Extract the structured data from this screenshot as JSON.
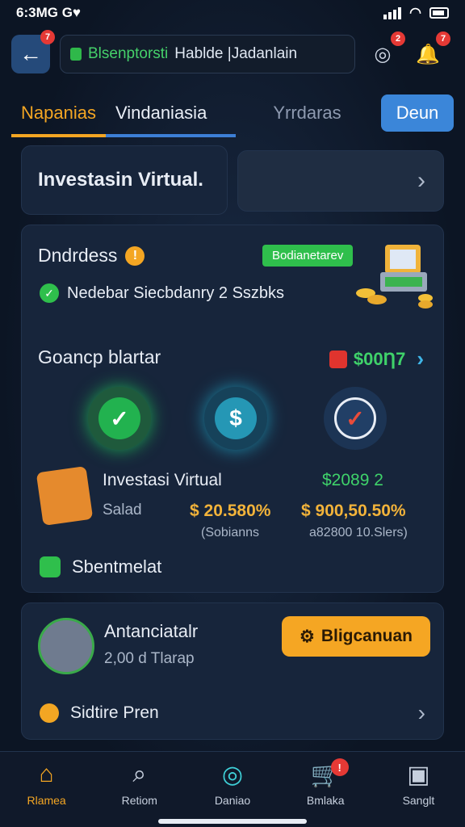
{
  "status": {
    "time": "6:3MG",
    "carrier": "G♥"
  },
  "header": {
    "back_badge": "7",
    "url_brand": "Blsenptorsti",
    "url_rest": "Hablde |Jadanlain",
    "icon1_badge": "2",
    "icon2_badge": "7"
  },
  "tabs": [
    "Napanias",
    "Vindaniasia",
    "Yrrdaras"
  ],
  "deun_label": "Deun",
  "card_a_title": "Investasin Virtual.",
  "section1": {
    "title": "Dndrdess",
    "tag": "Bodianetarev",
    "check_text": "Nedebar Siecbdanry 2 Sszbks"
  },
  "section2": {
    "title": "Goancp blartar",
    "right_value": "$00Ƞ7"
  },
  "investment": {
    "label": "Investasi Virtual",
    "sub": "Salad",
    "value_mid": "$ 20.580%",
    "value_right_top": "$2089 2",
    "value_right": "$ 900,50.50%",
    "sub_mid": "(Sobianns",
    "sub_right": "a82800 10.Slers)"
  },
  "footer_line": "Sbentmelat",
  "promo": {
    "title": "Antanciatalr",
    "sub": "2,00 d Tlarap",
    "button": "Bligcanuan",
    "settings": "Sidtire Pren"
  },
  "nav": [
    {
      "label": "Rlamea",
      "icon": "home-icon"
    },
    {
      "label": "Retiom",
      "icon": "search-user-icon"
    },
    {
      "label": "Daniao",
      "icon": "target-icon"
    },
    {
      "label": "Bmlaka",
      "icon": "cart-icon",
      "badge": "!"
    },
    {
      "label": "Sanglt",
      "icon": "wallet-icon"
    }
  ],
  "colors": {
    "accent": "#f4a623",
    "primary": "#3b86d9",
    "success": "#2fbf4c",
    "danger": "#e53935"
  }
}
